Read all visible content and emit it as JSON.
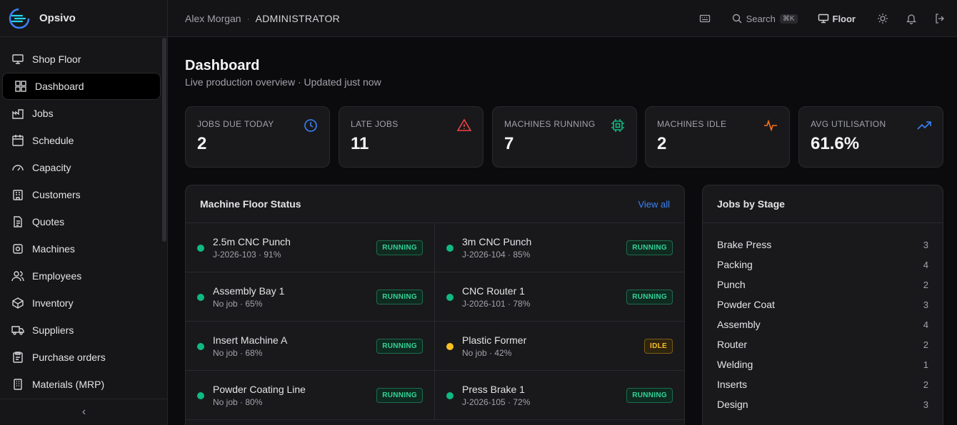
{
  "brand": {
    "name": "Opsivo"
  },
  "sidebar": {
    "items": [
      {
        "label": "Shop Floor",
        "icon": "monitor-icon"
      },
      {
        "label": "Dashboard",
        "icon": "dashboard-icon",
        "active": true
      },
      {
        "label": "Jobs",
        "icon": "factory-icon"
      },
      {
        "label": "Schedule",
        "icon": "calendar-icon"
      },
      {
        "label": "Capacity",
        "icon": "gauge-icon"
      },
      {
        "label": "Customers",
        "icon": "users-icon"
      },
      {
        "label": "Quotes",
        "icon": "document-icon"
      },
      {
        "label": "Machines",
        "icon": "cog-icon"
      },
      {
        "label": "Employees",
        "icon": "people-icon"
      },
      {
        "label": "Inventory",
        "icon": "box-icon"
      },
      {
        "label": "Suppliers",
        "icon": "truck-icon"
      },
      {
        "label": "Purchase orders",
        "icon": "clipboard-icon"
      },
      {
        "label": "Materials (MRP)",
        "icon": "building-icon"
      }
    ],
    "collapse_glyph": "‹"
  },
  "header": {
    "user_name": "Alex Morgan",
    "separator": "·",
    "user_role": "ADMINISTRATOR",
    "search_label": "Search",
    "search_shortcut": "⌘K",
    "floor_label": "Floor"
  },
  "page": {
    "title": "Dashboard",
    "subtitle": "Live production overview · Updated just now"
  },
  "kpis": [
    {
      "label": "JOBS DUE TODAY",
      "value": "2",
      "icon": "clock-icon",
      "color": "#3b82f6"
    },
    {
      "label": "LATE JOBS",
      "value": "11",
      "icon": "alert-triangle-icon",
      "color": "#ef4444"
    },
    {
      "label": "MACHINES RUNNING",
      "value": "7",
      "icon": "cpu-icon",
      "color": "#10b981"
    },
    {
      "label": "MACHINES IDLE",
      "value": "2",
      "icon": "activity-icon",
      "color": "#f97316"
    },
    {
      "label": "AVG UTILISATION",
      "value": "61.6%",
      "icon": "trending-up-icon",
      "color": "#3b82f6"
    }
  ],
  "machine_panel": {
    "title": "Machine Floor Status",
    "view_all": "View all",
    "machines": [
      {
        "name": "2.5m CNC Punch",
        "meta": "J-2026-103 · 91%",
        "status": "RUNNING"
      },
      {
        "name": "3m CNC Punch",
        "meta": "J-2026-104 · 85%",
        "status": "RUNNING"
      },
      {
        "name": "Assembly Bay 1",
        "meta": "No job · 65%",
        "status": "RUNNING"
      },
      {
        "name": "CNC Router 1",
        "meta": "J-2026-101 · 78%",
        "status": "RUNNING"
      },
      {
        "name": "Insert Machine A",
        "meta": "No job · 68%",
        "status": "RUNNING"
      },
      {
        "name": "Plastic Former",
        "meta": "No job · 42%",
        "status": "IDLE"
      },
      {
        "name": "Powder Coating Line",
        "meta": "No job · 80%",
        "status": "RUNNING"
      },
      {
        "name": "Press Brake 1",
        "meta": "J-2026-105 · 72%",
        "status": "RUNNING"
      }
    ]
  },
  "stage_panel": {
    "title": "Jobs by Stage",
    "stages": [
      {
        "name": "Brake Press",
        "count": "3"
      },
      {
        "name": "Packing",
        "count": "4"
      },
      {
        "name": "Punch",
        "count": "2"
      },
      {
        "name": "Powder Coat",
        "count": "3"
      },
      {
        "name": "Assembly",
        "count": "4"
      },
      {
        "name": "Router",
        "count": "2"
      },
      {
        "name": "Welding",
        "count": "1"
      },
      {
        "name": "Inserts",
        "count": "2"
      },
      {
        "name": "Design",
        "count": "3"
      }
    ]
  },
  "colors": {
    "running": "#10b981",
    "idle": "#fbbf24",
    "accent": "#3b82f6"
  }
}
